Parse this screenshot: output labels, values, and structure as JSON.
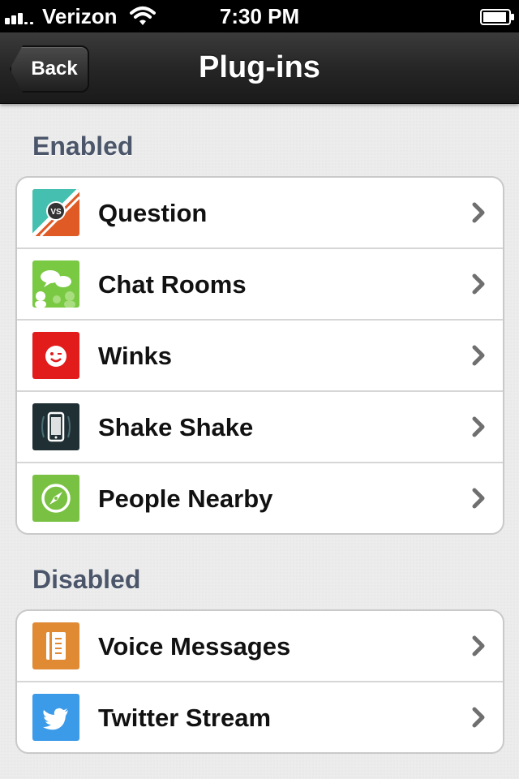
{
  "status_bar": {
    "carrier": "Verizon",
    "time": "7:30 PM"
  },
  "nav": {
    "back_label": "Back",
    "title": "Plug-ins"
  },
  "sections": {
    "enabled": {
      "header": "Enabled",
      "items": [
        {
          "label": "Question",
          "icon": "question-vs-icon"
        },
        {
          "label": "Chat Rooms",
          "icon": "chat-rooms-icon"
        },
        {
          "label": "Winks",
          "icon": "winks-icon"
        },
        {
          "label": "Shake Shake",
          "icon": "shake-phone-icon"
        },
        {
          "label": "People Nearby",
          "icon": "compass-icon"
        }
      ]
    },
    "disabled": {
      "header": "Disabled",
      "items": [
        {
          "label": "Voice Messages",
          "icon": "voice-notebook-icon"
        },
        {
          "label": "Twitter Stream",
          "icon": "twitter-bird-icon"
        }
      ]
    }
  },
  "colors": {
    "section_header": "#4c566a",
    "question": "#e05a26",
    "chat_rooms": "#7ac943",
    "winks": "#e21b1b",
    "shake_shake": "#1f2f33",
    "people_nearby": "#79c142",
    "voice_messages": "#e08a34",
    "twitter_stream": "#3c9be8"
  }
}
